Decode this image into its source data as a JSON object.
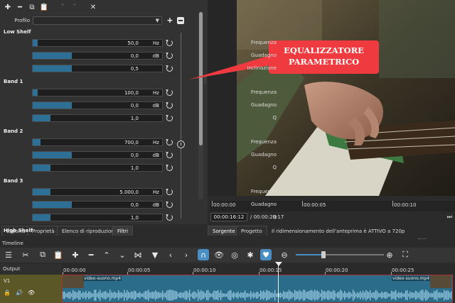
{
  "filter_panel": {
    "profile_label": "Profilo",
    "profile_value": "",
    "sections": [
      {
        "title": "Low Shelf",
        "params": [
          {
            "label": "Frequenza",
            "value": "50,0",
            "unit": "Hz",
            "fill": 0.04
          },
          {
            "label": "Guadagno",
            "value": "0,0",
            "unit": "dB",
            "fill": 0.3
          },
          {
            "label": "Inclinazione",
            "value": "0,5",
            "unit": "",
            "fill": 0.3
          }
        ]
      },
      {
        "title": "Band 1",
        "params": [
          {
            "label": "Frequenza",
            "value": "100,0",
            "unit": "Hz",
            "fill": 0.04
          },
          {
            "label": "Guadagno",
            "value": "0,0",
            "unit": "dB",
            "fill": 0.3
          },
          {
            "label": "Q",
            "value": "1,0",
            "unit": "",
            "fill": 0.14
          }
        ]
      },
      {
        "title": "Band 2",
        "params": [
          {
            "label": "Frequenza",
            "value": "700,0",
            "unit": "Hz",
            "fill": 0.06
          },
          {
            "label": "Guadagno",
            "value": "0,0",
            "unit": "dB",
            "fill": 0.3
          },
          {
            "label": "Q",
            "value": "1,0",
            "unit": "",
            "fill": 0.14
          }
        ]
      },
      {
        "title": "Band 3",
        "params": [
          {
            "label": "Frequenza",
            "value": "5.000,0",
            "unit": "Hz",
            "fill": 0.14
          },
          {
            "label": "Guadagno",
            "value": "0,0",
            "unit": "dB",
            "fill": 0.3
          },
          {
            "label": "Q",
            "value": "1,0",
            "unit": "",
            "fill": 0.14
          }
        ]
      },
      {
        "title": "High Shelf",
        "params": []
      }
    ]
  },
  "callout": {
    "line1": "EQUALIZZATORE",
    "line2": "PARAMETRICO",
    "color": "#ef3b3f"
  },
  "player": {
    "ruler_ticks": [
      "00:00:00",
      "00:00:05",
      "00:00:10"
    ],
    "timecode_current": "00:00:16:12",
    "timecode_total": "/ 00:00:29:17"
  },
  "tabs_left": [
    "Esporta",
    "Proprietà",
    "Elenco di riproduzione",
    "Filtri"
  ],
  "tabs_right": [
    "Sorgente",
    "Progetto"
  ],
  "status_message": "Il ridimensionamento dell'anteprima è ATTIVO a 720p",
  "timeline": {
    "title": "Timeline",
    "output_label": "Output",
    "track_name": "V1",
    "ruler_ticks": [
      "00:00:00",
      "00:00:05",
      "00:00:10",
      "00:00:15",
      "00:00:20",
      "00:00:25"
    ],
    "clip_name_a": "video-suono.mp4",
    "clip_name_b": "video-suono.mp4",
    "accent": "#4a8fc4"
  }
}
